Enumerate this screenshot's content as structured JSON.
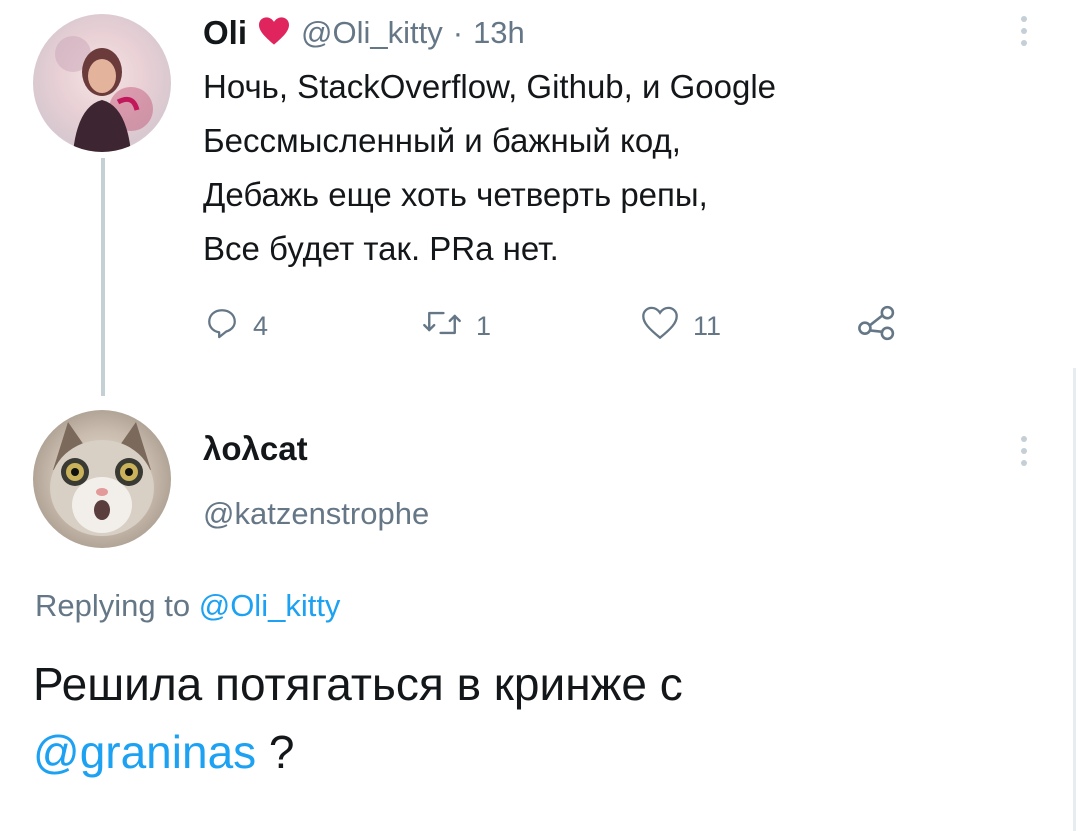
{
  "tweet1": {
    "name": "Oli",
    "handle": "@Oli_kitty",
    "time_sep": "·",
    "time": "13h",
    "lines": [
      "Ночь, StackOverflow, Github, и Google",
      "Бессмысленный и бажный код,",
      "Дебажь еще хоть четверть репы,",
      "Все будет так. PRa нет."
    ],
    "actions": {
      "reply_count": "4",
      "retweet_count": "1",
      "like_count": "11"
    }
  },
  "tweet2": {
    "name": "λoλcat",
    "handle": "@katzenstrophe",
    "replying_prefix": "Replying to",
    "replying_handle": "@Oli_kitty",
    "text_line1": "Решила потягаться в кринже с",
    "mention": "@graninas",
    "text_end": " ?"
  },
  "icons": [
    "heart-icon",
    "reply-icon",
    "retweet-icon",
    "like-icon",
    "share-icon",
    "more-icon"
  ],
  "colors": {
    "heart": "#e0245e",
    "link": "#1da1f2",
    "muted": "#657786",
    "thread_line": "#c4cfd6"
  }
}
